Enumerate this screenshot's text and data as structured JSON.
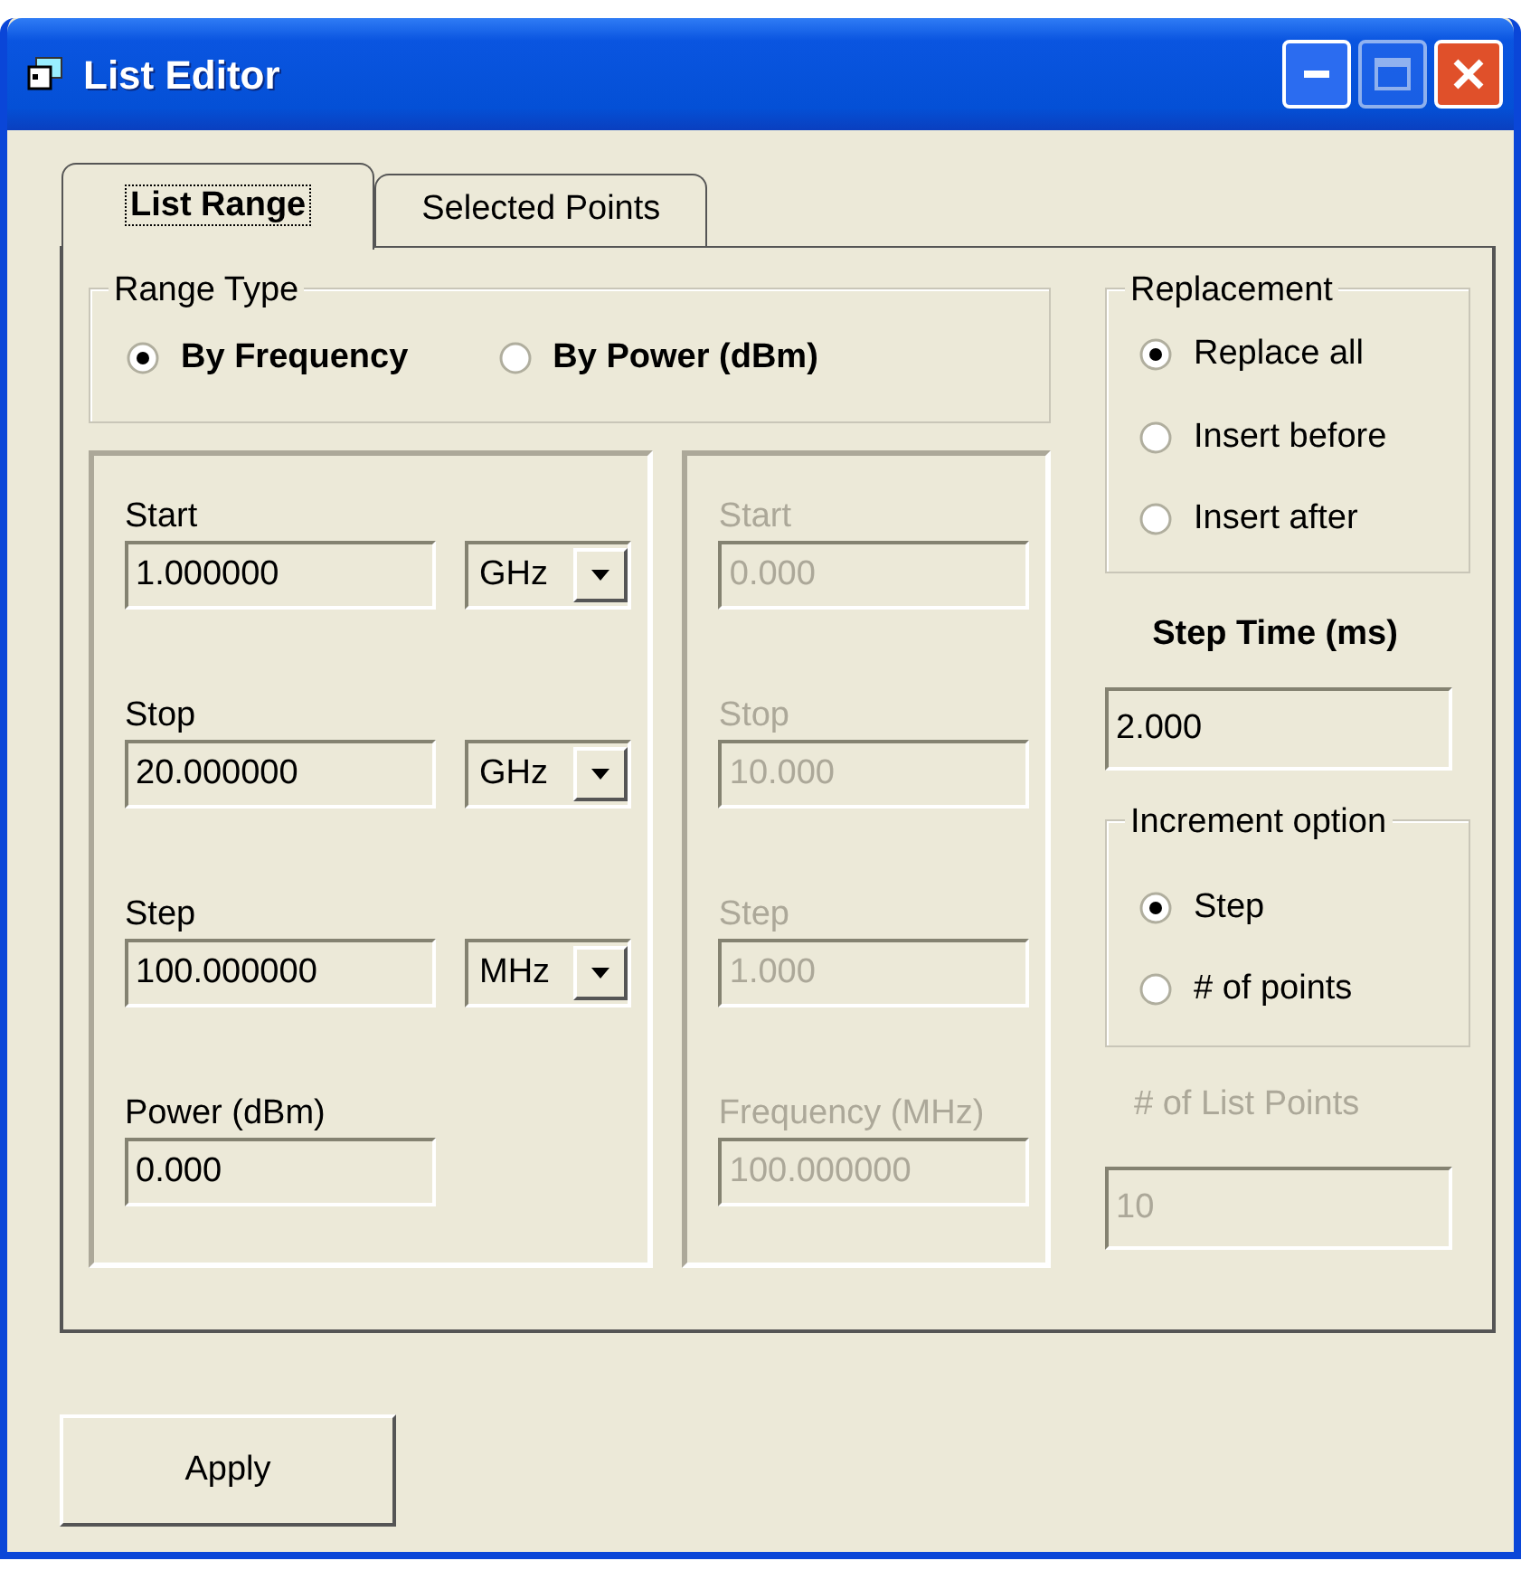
{
  "window": {
    "title": "List Editor"
  },
  "tabs": [
    {
      "label": "List Range",
      "selected": true
    },
    {
      "label": "Selected Points",
      "selected": false
    }
  ],
  "range_type": {
    "label": "Range Type",
    "options": [
      {
        "label": "By Frequency",
        "selected": true
      },
      {
        "label": "By Power (dBm)",
        "selected": false
      }
    ]
  },
  "frequency_group": {
    "disabled": false,
    "fields": [
      {
        "label": "Start",
        "value": "1.000000",
        "unit": "GHz"
      },
      {
        "label": "Stop",
        "value": "20.000000",
        "unit": "GHz"
      },
      {
        "label": "Step",
        "value": "100.000000",
        "unit": "MHz"
      },
      {
        "label": "Power (dBm)",
        "value": "0.000"
      }
    ]
  },
  "power_group": {
    "disabled": true,
    "fields": [
      {
        "label": "Start",
        "value": "0.000"
      },
      {
        "label": "Stop",
        "value": "10.000"
      },
      {
        "label": "Step",
        "value": "1.000"
      },
      {
        "label": "Frequency (MHz)",
        "value": "100.000000"
      }
    ]
  },
  "replacement": {
    "label": "Replacement",
    "options": [
      {
        "label": "Replace all",
        "selected": true
      },
      {
        "label": "Insert before",
        "selected": false
      },
      {
        "label": "Insert after",
        "selected": false
      }
    ]
  },
  "step_time": {
    "label": "Step Time (ms)",
    "value": "2.000"
  },
  "increment_option": {
    "label": "Increment option",
    "options": [
      {
        "label": "Step",
        "selected": true
      },
      {
        "label": "# of points",
        "selected": false
      }
    ]
  },
  "list_points": {
    "label": "# of List Points",
    "value": "10",
    "disabled": true
  },
  "apply_button": "Apply"
}
